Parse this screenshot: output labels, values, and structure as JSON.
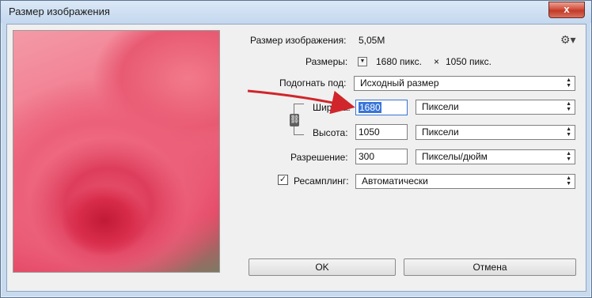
{
  "window": {
    "title": "Размер изображения",
    "close_glyph": "x"
  },
  "info": {
    "image_size_label": "Размер изображения:",
    "image_size_value": "5,05M",
    "dimensions_label": "Размеры:",
    "dimensions_width": "1680 пикс.",
    "dimensions_times": "×",
    "dimensions_height": "1050 пикс."
  },
  "fit_to": {
    "label": "Подогнать под:",
    "value": "Исходный размер"
  },
  "width": {
    "label": "Ширина:",
    "value": "1680",
    "unit": "Пиксели"
  },
  "height": {
    "label": "Высота:",
    "value": "1050",
    "unit": "Пиксели"
  },
  "resolution": {
    "label": "Разрешение:",
    "value": "300",
    "unit": "Пикселы/дюйм"
  },
  "resample": {
    "label": "Ресамплинг:",
    "checked": true,
    "value": "Автоматически"
  },
  "buttons": {
    "ok": "OK",
    "cancel": "Отмена"
  },
  "icons": {
    "gear": "gear-icon",
    "constrain": "chain-link-icon",
    "dropdown": "up-down-arrows-icon",
    "annotation": "red-arrow-icon"
  },
  "colors": {
    "selection": "#3874d8",
    "annotation_arrow": "#d0262b",
    "close_button": "#c13a27"
  }
}
